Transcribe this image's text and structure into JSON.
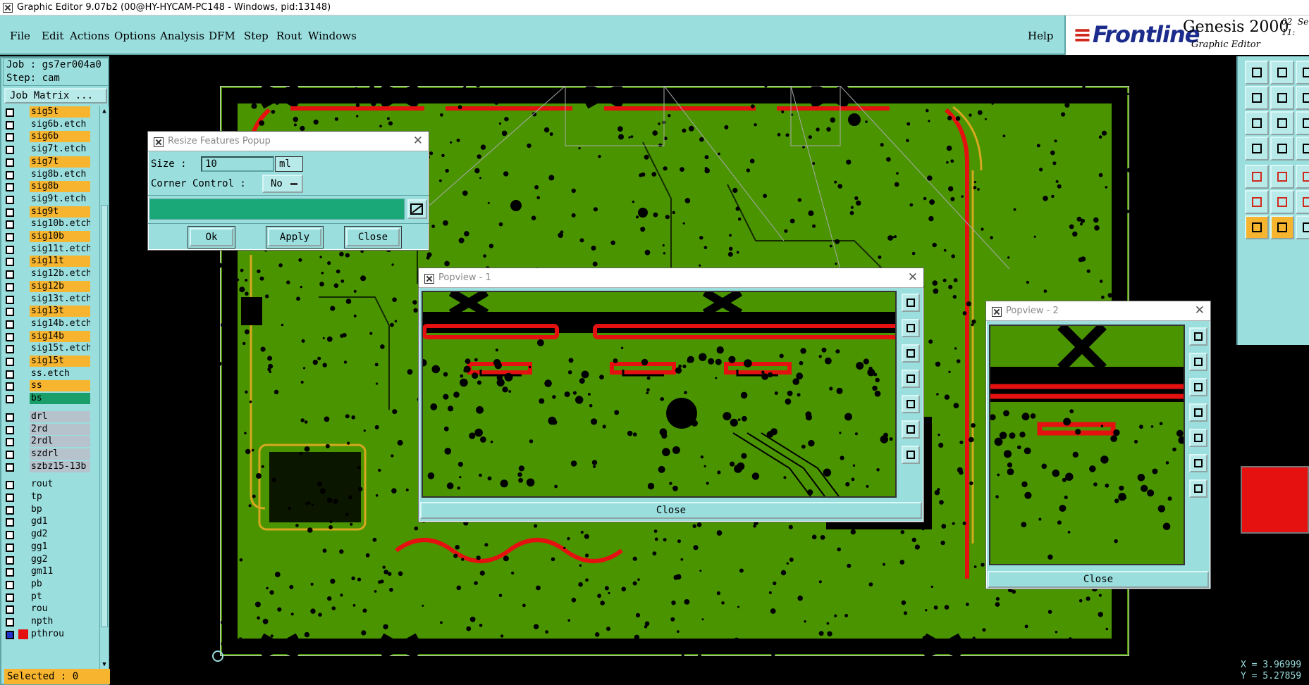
{
  "window": {
    "title": "Graphic Editor 9.07b2 (00@HY-HYCAM-PC148 - Windows, pid:13148)"
  },
  "menu": {
    "file": "File",
    "edit": "Edit",
    "actions": "Actions",
    "options": "Options",
    "analysis": "Analysis",
    "dfm": "DFM",
    "step": "Step",
    "rout": "Rout",
    "windows": "Windows",
    "help": "Help"
  },
  "brand": {
    "logo": "Frontline",
    "product": "Genesis 2000",
    "subtitle": "Graphic Editor",
    "date": "02  Se\n11:"
  },
  "job": {
    "job_line": "Job : gs7er004a0",
    "step_line": "Step: cam",
    "matrix_button": "Job Matrix ..."
  },
  "layers": [
    {
      "name": "sig5t",
      "bg": "#f7b52f"
    },
    {
      "name": "sig6b.etch",
      "bg": "#9bdede"
    },
    {
      "name": "sig6b",
      "bg": "#f7b52f"
    },
    {
      "name": "sig7t.etch",
      "bg": "#9bdede"
    },
    {
      "name": "sig7t",
      "bg": "#f7b52f"
    },
    {
      "name": "sig8b.etch",
      "bg": "#9bdede"
    },
    {
      "name": "sig8b",
      "bg": "#f7b52f"
    },
    {
      "name": "sig9t.etch",
      "bg": "#9bdede"
    },
    {
      "name": "sig9t",
      "bg": "#f7b52f"
    },
    {
      "name": "sig10b.etch",
      "bg": "#9bdede"
    },
    {
      "name": "sig10b",
      "bg": "#f7b52f"
    },
    {
      "name": "sig11t.etch",
      "bg": "#9bdede"
    },
    {
      "name": "sig11t",
      "bg": "#f7b52f"
    },
    {
      "name": "sig12b.etch",
      "bg": "#9bdede"
    },
    {
      "name": "sig12b",
      "bg": "#f7b52f"
    },
    {
      "name": "sig13t.etch",
      "bg": "#9bdede"
    },
    {
      "name": "sig13t",
      "bg": "#f7b52f"
    },
    {
      "name": "sig14b.etch",
      "bg": "#9bdede"
    },
    {
      "name": "sig14b",
      "bg": "#f7b52f"
    },
    {
      "name": "sig15t.etch",
      "bg": "#9bdede"
    },
    {
      "name": "sig15t",
      "bg": "#f7b52f"
    },
    {
      "name": "ss.etch",
      "bg": "#9bdede"
    },
    {
      "name": "ss",
      "bg": "#f7b52f"
    },
    {
      "name": "bs",
      "bg": "#1a9e6a"
    },
    {
      "name": "drl",
      "bg": "#b6c2cc"
    },
    {
      "name": "2rd",
      "bg": "#b6c2cc"
    },
    {
      "name": "2rdl",
      "bg": "#b6c2cc"
    },
    {
      "name": "szdrl",
      "bg": "#b6c2cc"
    },
    {
      "name": "szbz15-13b",
      "bg": "#b6c2cc"
    },
    {
      "name": "rout",
      "bg": "#9bdede"
    },
    {
      "name": "tp",
      "bg": "#9bdede"
    },
    {
      "name": "bp",
      "bg": "#9bdede"
    },
    {
      "name": "gd1",
      "bg": "#9bdede"
    },
    {
      "name": "gd2",
      "bg": "#9bdede"
    },
    {
      "name": "gg1",
      "bg": "#9bdede"
    },
    {
      "name": "gg2",
      "bg": "#9bdede"
    },
    {
      "name": "gm11",
      "bg": "#9bdede"
    },
    {
      "name": "pb",
      "bg": "#9bdede"
    },
    {
      "name": "pt",
      "bg": "#9bdede"
    },
    {
      "name": "rou",
      "bg": "#9bdede"
    },
    {
      "name": "npth",
      "bg": "#9bdede"
    },
    {
      "name": "pthrou",
      "bg": "#9bdede"
    }
  ],
  "selected_text": "Selected : 0",
  "resize_popup": {
    "title": "Resize Features Popup",
    "size_label": "Size :",
    "size_value": "10",
    "size_unit": "ml",
    "corner_label": "Corner Control :",
    "corner_value": "No",
    "ok": "Ok",
    "apply": "Apply",
    "close": "Close"
  },
  "popview1": {
    "title": "Popview - 1",
    "close": "Close"
  },
  "popview2": {
    "title": "Popview - 2",
    "close": "Close"
  },
  "coords": {
    "x": "X = 3.96999",
    "y": "Y = 5.27859"
  },
  "colors": {
    "accent": "#9bdede",
    "highlight": "#f7b52f",
    "board": "#4a9400",
    "feature": "#e51111"
  }
}
